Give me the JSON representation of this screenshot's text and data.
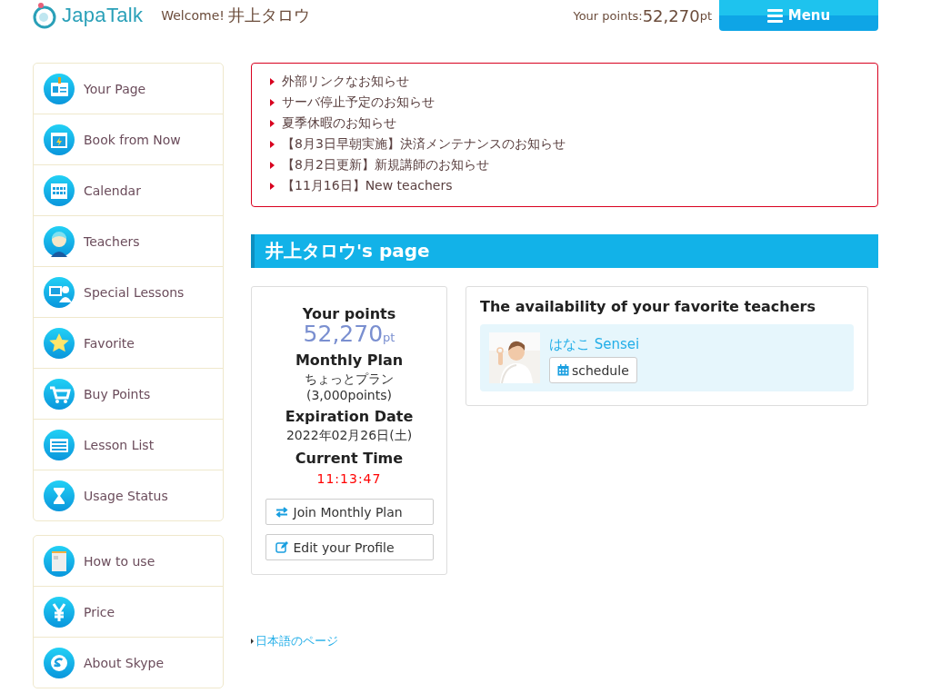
{
  "header": {
    "logo": "JapaTalk",
    "welcome_label": "Welcome!",
    "user_name": "井上タロウ",
    "points_label": "Your points:",
    "points_value": "52,270",
    "points_unit": "pt",
    "menu_button": "Menu"
  },
  "sidebar": {
    "groups": [
      {
        "items": [
          {
            "label": "Your Page"
          },
          {
            "label": "Book from Now"
          },
          {
            "label": "Calendar"
          },
          {
            "label": "Teachers"
          },
          {
            "label": "Special Lessons"
          },
          {
            "label": "Favorite"
          },
          {
            "label": "Buy Points"
          },
          {
            "label": "Lesson List"
          },
          {
            "label": "Usage Status"
          }
        ]
      },
      {
        "items": [
          {
            "label": "How to use"
          },
          {
            "label": "Price"
          },
          {
            "label": "About Skype"
          }
        ]
      }
    ]
  },
  "notices": [
    "外部リンクなお知らせ",
    "サーバ停止予定のお知らせ",
    "夏季休暇のお知らせ",
    "【8月3日早朝実施】決済メンテナンスのお知らせ",
    "【8月2日更新】新規講師のお知らせ",
    "【11月16日】New teachers"
  ],
  "page_title": "井上タロウ's page",
  "summary": {
    "points_heading": "Your points",
    "points_value": "52,270",
    "points_unit": "pt",
    "plan_heading": "Monthly Plan",
    "plan_name": "ちょっとプラン",
    "plan_points": "(3,000points)",
    "expiration_heading": "Expiration Date",
    "expiration_date": "2022年02月26日(土)",
    "time_heading": "Current Time",
    "current_time": "11:13:47",
    "buttons": [
      {
        "label": "Join Monthly Plan",
        "kind": "exchange"
      },
      {
        "label": "Edit your Profile",
        "kind": "edit"
      }
    ]
  },
  "favorites": {
    "title": "The availability of your favorite teachers",
    "teachers": [
      {
        "name": "はなこ Sensei",
        "button": "schedule"
      }
    ]
  },
  "footer_link": "日本語のページ"
}
